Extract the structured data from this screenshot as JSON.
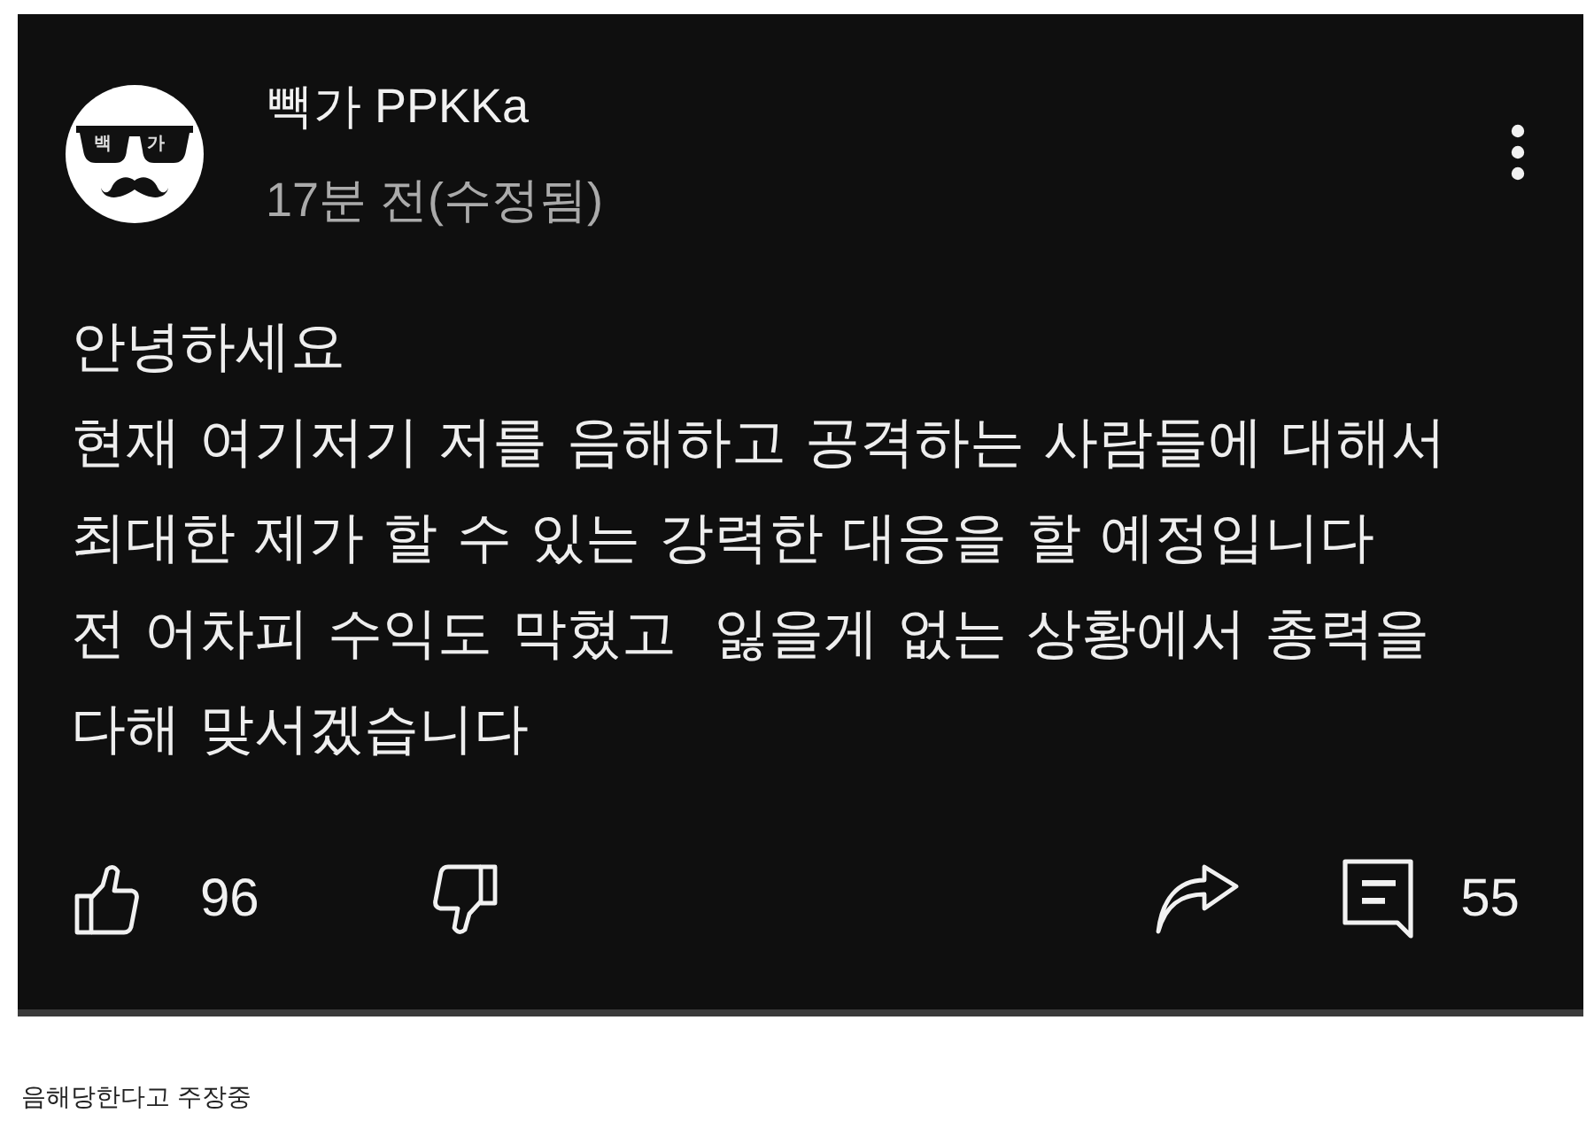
{
  "comment": {
    "avatar": {
      "lens_texts": [
        "백",
        "가"
      ]
    },
    "author": "빽가 PPKKa",
    "time": "17분 전(수정됨)",
    "body": "안녕하세요\n현재 여기저기 저를 음해하고 공격하는 사람들에 대해서\n최대한 제가 할 수 있는 강력한 대응을 할 예정입니다\n전 어차피 수익도 막혔고  잃을게 없는 상황에서 총력을\n다해 맞서겠습니다",
    "like_count": "96",
    "reply_count": "55"
  },
  "caption": "음해당한다고 주장중"
}
